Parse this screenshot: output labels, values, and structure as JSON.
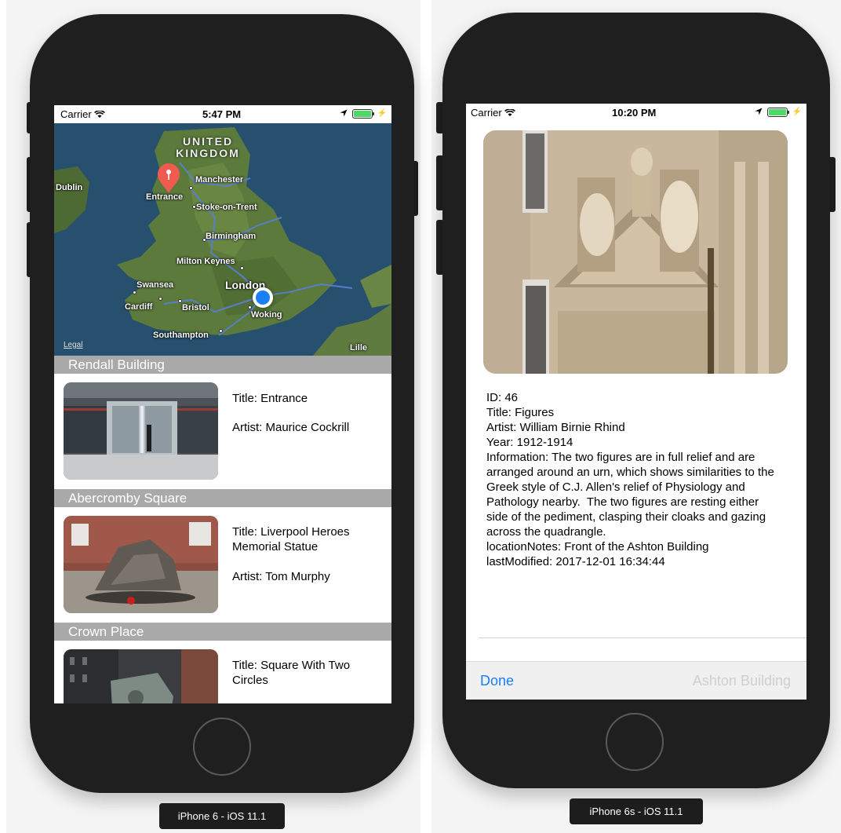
{
  "left_device": {
    "label": "iPhone 6 - iOS 11.1",
    "status": {
      "carrier": "Carrier",
      "time": "5:47 PM"
    },
    "map": {
      "region_label": "UNITED KINGDOM",
      "legal": "Legal",
      "pin_label": "Entrance",
      "cities": [
        "Dublin",
        "Manchester",
        "Stoke-on-Trent",
        "Birmingham",
        "Milton Keynes",
        "Swansea",
        "London",
        "Cardiff",
        "Bristol",
        "Woking",
        "Southampton",
        "Lille"
      ]
    },
    "sections": [
      {
        "header": "Rendall Building",
        "title": "Title: Entrance",
        "artist": "Artist: Maurice Cockrill"
      },
      {
        "header": "Abercromby Square",
        "title": "Title: Liverpool Heroes Memorial Statue",
        "artist": "Artist: Tom Murphy"
      },
      {
        "header": "Crown Place",
        "title": "Title: Square With Two Circles",
        "artist": ""
      }
    ]
  },
  "right_device": {
    "label": "iPhone 6s - iOS 11.1",
    "status": {
      "carrier": "Carrier",
      "time": "10:20 PM"
    },
    "details": {
      "id": "ID: 46",
      "title": "Title: Figures",
      "artist": "Artist: William Birnie Rhind",
      "year": "Year: 1912-1914",
      "information": "Information: The two figures are in full relief and are arranged around an urn, which shows similarities to the Greek style of C.J. Allen's relief of Physiology and Pathology nearby.  The two figures are resting either side of the pediment, clasping their cloaks and gazing across the quadrangle.",
      "location_notes": "locationNotes: Front of the Ashton Building",
      "last_modified": "lastModified: 2017-12-01 16:34:44"
    },
    "toolbar": {
      "done": "Done",
      "location": "Ashton Building"
    }
  },
  "colors": {
    "accent": "#1a7ef5",
    "section_header": "#a9a9a9",
    "battery": "#4cd964",
    "pin": "#f05b4f",
    "user_dot": "#1a7ef5"
  }
}
